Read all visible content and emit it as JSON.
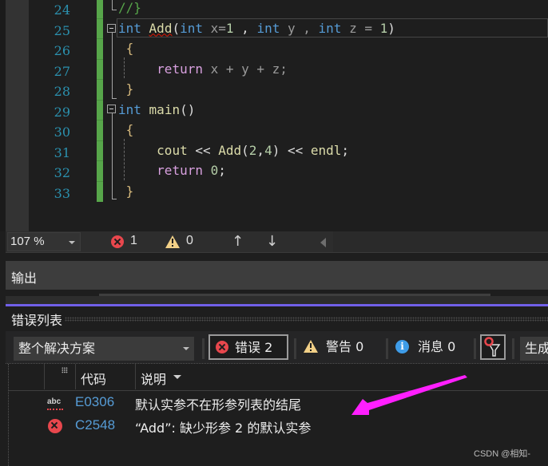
{
  "editor": {
    "line_numbers": [
      "24",
      "25",
      "26",
      "27",
      "28",
      "29",
      "30",
      "31",
      "32",
      "33"
    ],
    "code_lines": [
      [
        {
          "t": "//}",
          "c": "cm"
        }
      ],
      [
        {
          "t": "int",
          "c": "kw"
        },
        {
          "t": " ",
          "c": "plain"
        },
        {
          "t": "Add",
          "c": "fn squiggle"
        },
        {
          "t": "(",
          "c": "plain"
        },
        {
          "t": "int",
          "c": "kw"
        },
        {
          "t": " x=",
          "c": "param"
        },
        {
          "t": "1",
          "c": "num"
        },
        {
          "t": " , ",
          "c": "plain"
        },
        {
          "t": "int",
          "c": "kw"
        },
        {
          "t": " y , ",
          "c": "param"
        },
        {
          "t": "int",
          "c": "kw"
        },
        {
          "t": " z = ",
          "c": "param"
        },
        {
          "t": "1",
          "c": "num"
        },
        {
          "t": ")",
          "c": "plain"
        }
      ],
      [
        {
          "t": " {",
          "c": "br"
        }
      ],
      [
        {
          "t": "     ",
          "c": "plain"
        },
        {
          "t": "return",
          "c": "ctl"
        },
        {
          "t": " x + y + z;",
          "c": "param"
        }
      ],
      [
        {
          "t": " }",
          "c": "br"
        }
      ],
      [
        {
          "t": "int",
          "c": "kw"
        },
        {
          "t": " ",
          "c": "plain"
        },
        {
          "t": "main",
          "c": "fn"
        },
        {
          "t": "()",
          "c": "plain"
        }
      ],
      [
        {
          "t": " {",
          "c": "br"
        }
      ],
      [
        {
          "t": "     ",
          "c": "plain"
        },
        {
          "t": "cout",
          "c": "fn"
        },
        {
          "t": " << ",
          "c": "plain"
        },
        {
          "t": "Add",
          "c": "fn"
        },
        {
          "t": "(",
          "c": "plain"
        },
        {
          "t": "2",
          "c": "num"
        },
        {
          "t": ",",
          "c": "plain"
        },
        {
          "t": "4",
          "c": "num"
        },
        {
          "t": ") << ",
          "c": "plain"
        },
        {
          "t": "endl",
          "c": "fn"
        },
        {
          "t": ";",
          "c": "plain"
        }
      ],
      [
        {
          "t": "     ",
          "c": "plain"
        },
        {
          "t": "return",
          "c": "ctl"
        },
        {
          "t": " ",
          "c": "plain"
        },
        {
          "t": "0",
          "c": "num"
        },
        {
          "t": ";",
          "c": "plain"
        }
      ],
      [
        {
          "t": " }",
          "c": "br"
        }
      ]
    ]
  },
  "editor_status": {
    "zoom": "107 %",
    "error_count": "1",
    "warning_count": "0",
    "up_arrow": "↑",
    "down_arrow": "↓"
  },
  "output_panel": {
    "title": "输出"
  },
  "error_list": {
    "title": "错误列表",
    "scope_selected": "整个解决方案",
    "errors_label": "错误 2",
    "warnings_label": "警告 0",
    "messages_label": "消息 0",
    "build_label": "生成",
    "columns": {
      "code": "代码",
      "description": "说明"
    },
    "rows": [
      {
        "icon": "spell-squiggle-icon",
        "code": "E0306",
        "description": "默认实参不在形参列表的结尾"
      },
      {
        "icon": "error-icon",
        "code": "C2548",
        "description": "“Add”: 缺少形参 2 的默认实参"
      }
    ]
  },
  "annotation": {
    "arrow_color": "#ff1fff"
  },
  "watermark": "CSDN @相知-"
}
